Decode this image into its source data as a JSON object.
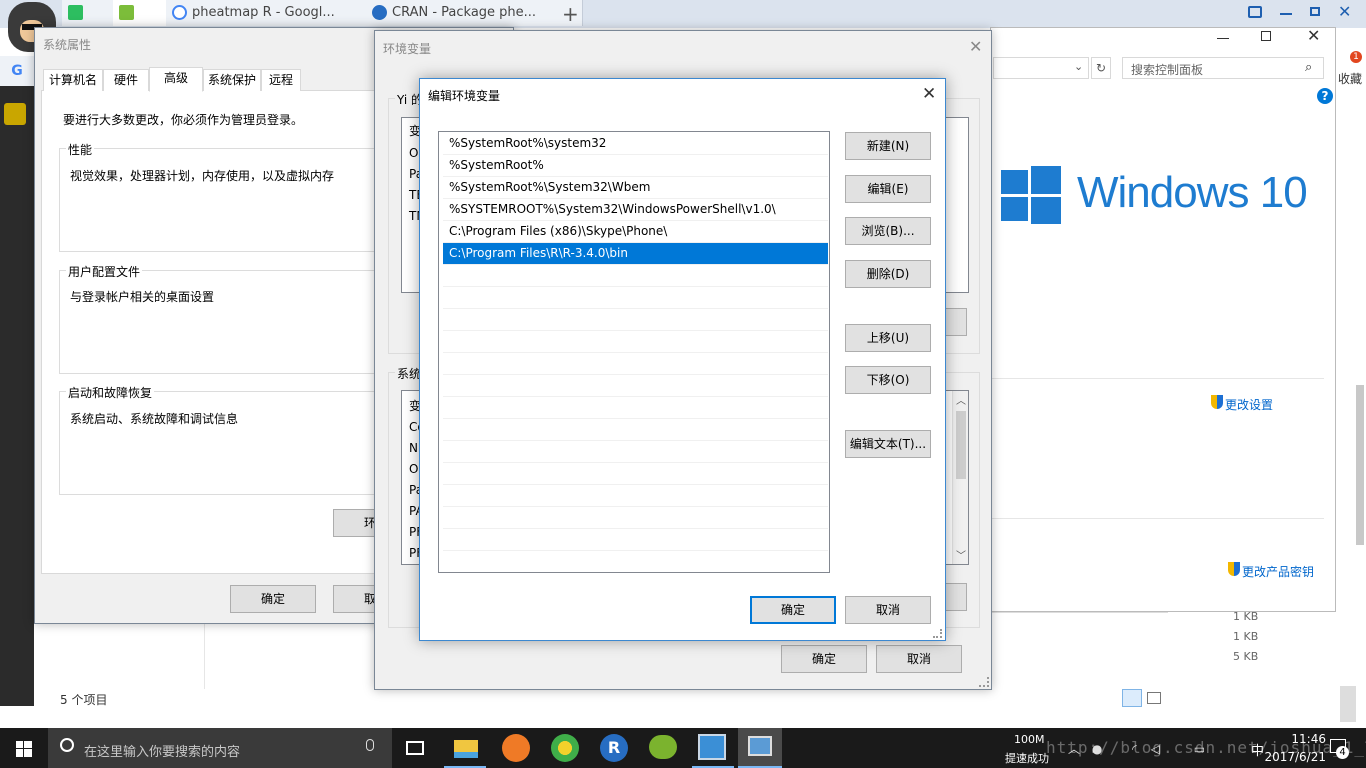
{
  "browser": {
    "tabs": [
      {
        "label": ""
      },
      {
        "label": ""
      },
      {
        "label": "pheatmap R - Googl..."
      },
      {
        "label": "CRAN - Package phe..."
      }
    ],
    "new_tab": "+"
  },
  "control_panel": {
    "search_placeholder": "搜索控制面板",
    "favorites_label": "收藏",
    "windows_logo_text": "Windows 10",
    "change_settings": "更改设置",
    "change_product_key": "更改产品密钥"
  },
  "explorer": {
    "item_count": "5 个项目",
    "file_sizes": [
      "1 KB",
      "1 KB",
      "5 KB"
    ]
  },
  "system_properties": {
    "title": "系统属性",
    "tabs": [
      "计算机名",
      "硬件",
      "高级",
      "系统保护",
      "远程"
    ],
    "admin_note": "要进行大多数更改，你必须作为管理员登录。",
    "performance": {
      "label": "性能",
      "desc": "视觉效果，处理器计划，内存使用，以及虚拟内存"
    },
    "user_profiles": {
      "label": "用户配置文件",
      "desc": "与登录帐户相关的桌面设置"
    },
    "startup": {
      "label": "启动和故障恢复",
      "desc": "系统启动、系统故障和调试信息"
    },
    "env_button_partial": "环",
    "ok": "确定",
    "cancel": "取消"
  },
  "env_vars": {
    "title": "环境变量",
    "user_group_partial": "Yi 的",
    "user_list_partial": [
      "变",
      "O",
      "Pa",
      "TE",
      "TM"
    ],
    "system_group_partial": "系统",
    "system_list_partial": [
      "变",
      "Co",
      "N",
      "O",
      "Pa",
      "PA",
      "PF",
      "PF"
    ],
    "ok": "确定",
    "cancel": "取消"
  },
  "edit_env": {
    "title": "编辑环境变量",
    "paths": [
      "%SystemRoot%\\system32",
      "%SystemRoot%",
      "%SystemRoot%\\System32\\Wbem",
      "%SYSTEMROOT%\\System32\\WindowsPowerShell\\v1.0\\",
      "C:\\Program Files (x86)\\Skype\\Phone\\",
      "C:\\Program Files\\R\\R-3.4.0\\bin"
    ],
    "selected_index": 5,
    "buttons": {
      "new": "新建(N)",
      "edit": "编辑(E)",
      "browse": "浏览(B)...",
      "delete": "删除(D)",
      "move_up": "上移(U)",
      "move_down": "下移(O)",
      "edit_text": "编辑文本(T)...",
      "ok": "确定",
      "cancel": "取消"
    }
  },
  "taskbar": {
    "search_placeholder": "在这里输入你要搜索的内容",
    "network_speed": "100M",
    "network_status": "提速成功",
    "ime": "中",
    "time": "11:46",
    "date": "2017/6/21",
    "notification_count": "4",
    "watermark": "http://blog.csdn.net/joshua_1_T"
  },
  "colors": {
    "accent": "#0078d7",
    "taskbar": "#1a1a1a",
    "win_logo": "#1e7cd0"
  }
}
